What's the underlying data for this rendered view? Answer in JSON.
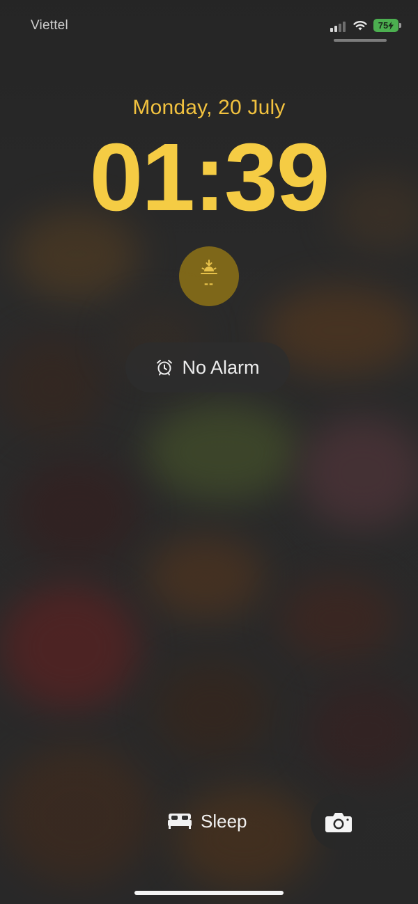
{
  "status_bar": {
    "carrier": "Viettel",
    "battery_level": "75",
    "battery_color": "#4caf50"
  },
  "lock_screen": {
    "date": "Monday, 20 July",
    "time": "01:39",
    "accent_color": "#f5cc44"
  },
  "widgets": {
    "sunrise": {
      "icon": "sunrise-icon",
      "value": "--"
    },
    "alarm": {
      "icon": "alarm-clock-icon",
      "label": "No Alarm"
    }
  },
  "bottom": {
    "sleep": {
      "icon": "bed-icon",
      "label": "Sleep"
    },
    "camera": {
      "icon": "camera-icon"
    }
  }
}
